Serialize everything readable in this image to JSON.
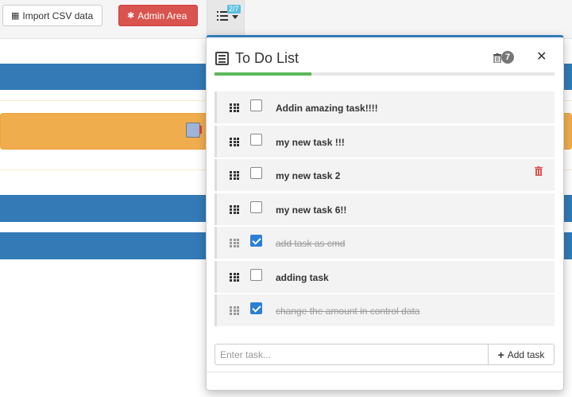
{
  "toolbar": {
    "import_label": "Import CSV data",
    "import_icon": "grid-icon",
    "admin_label": "Admin Area",
    "admin_icon": "gear-icon",
    "todo_badge": "2/7"
  },
  "todo": {
    "title": "To Do List",
    "count": "7",
    "progress": 0.286,
    "items": [
      {
        "label": "Addin amazing task!!!!",
        "done": false
      },
      {
        "label": "my new task !!!",
        "done": false
      },
      {
        "label": "my new task 2",
        "done": false
      },
      {
        "label": "my new task 6!!",
        "done": false
      },
      {
        "label": "add task as cmd",
        "done": true
      },
      {
        "label": "adding task",
        "done": false
      },
      {
        "label": "change the amount in control data",
        "done": true
      }
    ],
    "input_placeholder": "Enter task...",
    "add_label": "Add task"
  },
  "colors": {
    "primary": "#337ab7",
    "danger": "#d9534f",
    "warning": "#f0ad4e",
    "success": "#5cb85c",
    "info": "#5bc0de",
    "check": "#2b7fd6"
  }
}
